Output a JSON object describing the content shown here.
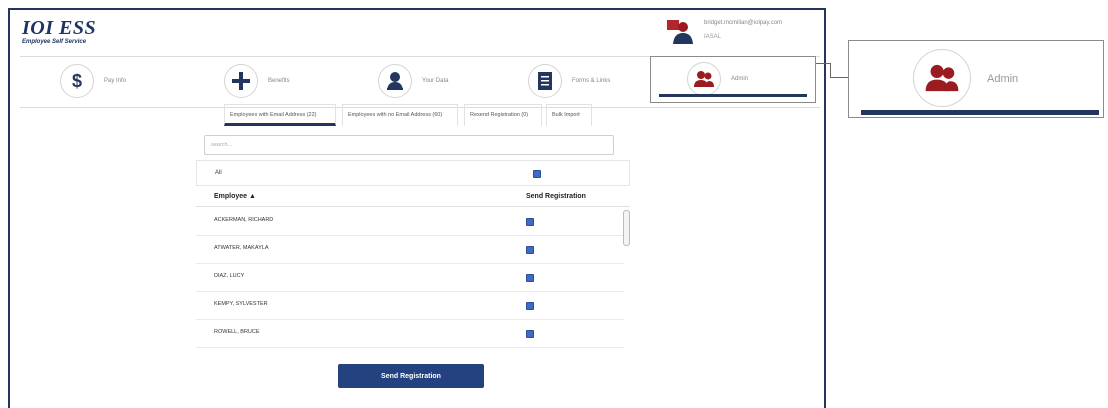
{
  "app": {
    "logo_text": "IOI ESS",
    "logo_subtitle": "Employee Self Service"
  },
  "user": {
    "email": "bridget.mcmilian@iolpay.com",
    "sub_label": "IASAL"
  },
  "nav": {
    "items": [
      {
        "label": "Pay Info",
        "icon": "dollar-icon"
      },
      {
        "label": "Benefits",
        "icon": "plus-icon"
      },
      {
        "label": "Your Data",
        "icon": "person-icon"
      },
      {
        "label": "Forms & Links",
        "icon": "document-icon"
      },
      {
        "label": "Admin",
        "icon": "people-icon"
      }
    ],
    "active": "Admin"
  },
  "tabs": [
    {
      "label": "Employees with Email Address (22)",
      "active": true
    },
    {
      "label": "Employees with no Email Address (60)",
      "active": false
    },
    {
      "label": "Resend Registration (0)",
      "active": false
    },
    {
      "label": "Bulk Import",
      "active": false
    }
  ],
  "search": {
    "placeholder": "search..."
  },
  "select_all": {
    "label": "All",
    "checked": true
  },
  "table": {
    "columns": [
      "Employee ▲",
      "Send Registration"
    ],
    "rows": [
      {
        "name": "ACKERMAN, RICHARD",
        "send": true
      },
      {
        "name": "ATWATER, MAKAYLA",
        "send": true
      },
      {
        "name": "DIAZ, LUCY",
        "send": true
      },
      {
        "name": "KEMPY, SYLVESTER",
        "send": true
      },
      {
        "name": "ROWELL, BRUCE",
        "send": true
      }
    ]
  },
  "send_button": {
    "label": "Send Registration"
  },
  "zoom_callout": {
    "label": "Admin"
  },
  "colors": {
    "navy": "#23375e",
    "button": "#23427f",
    "icon_red": "#9b1c20",
    "checkbox": "#3d6cc4"
  }
}
